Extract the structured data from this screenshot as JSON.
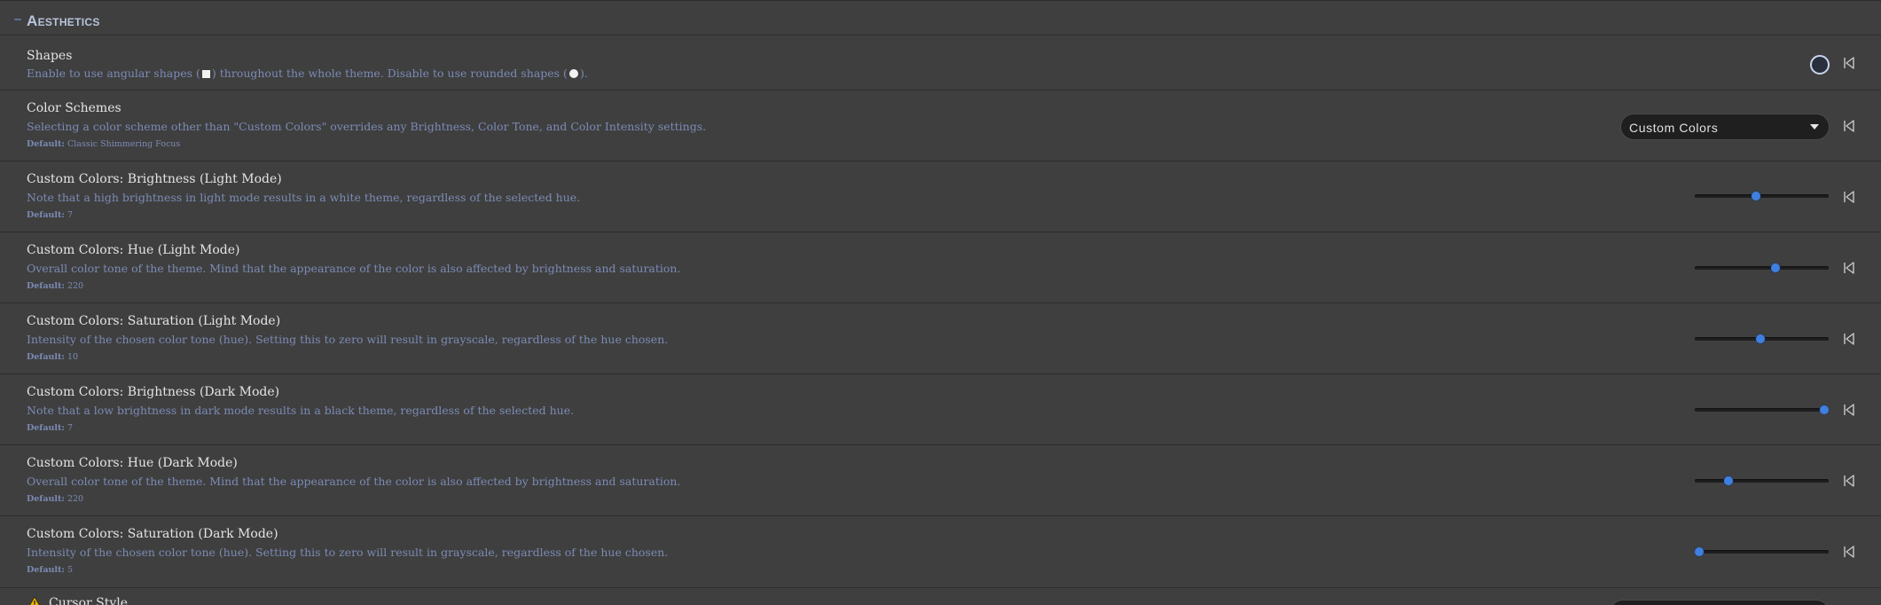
{
  "section": {
    "title": "Aesthetics"
  },
  "settings": [
    {
      "title": "Shapes",
      "desc_pre": "Enable to use angular shapes (",
      "desc_mid": ") throughout the whole theme. Disable to use rounded shapes (",
      "desc_post": ").",
      "control": "toggle",
      "toggle_on": false
    },
    {
      "title": "Color Schemes",
      "desc": "Selecting a color scheme other than \"Custom Colors\" overrides any Brightness, Color Tone, and Color Intensity settings.",
      "default_label": "Default:",
      "default_value": "Classic Shimmering Focus",
      "control": "select",
      "selected": "Custom Colors"
    },
    {
      "title": "Custom Colors: Brightness (Light Mode)",
      "desc": "Note that a high brightness in light mode results in a white theme, regardless of the selected hue.",
      "default_label": "Default:",
      "default_value": "7",
      "control": "slider",
      "slider_fraction": 0.46
    },
    {
      "title": "Custom Colors: Hue (Light Mode)",
      "desc": "Overall color tone of the theme. Mind that the appearance of the color is also affected by brightness and saturation.",
      "default_label": "Default:",
      "default_value": "220",
      "control": "slider",
      "slider_fraction": 0.6
    },
    {
      "title": "Custom Colors: Saturation (Light Mode)",
      "desc": "Intensity of the chosen color tone (hue). Setting this to zero will result in grayscale, regardless of the hue chosen.",
      "default_label": "Default:",
      "default_value": "10",
      "control": "slider",
      "slider_fraction": 0.49
    },
    {
      "title": "Custom Colors: Brightness (Dark Mode)",
      "desc": "Note that a low brightness in dark mode results in a black theme, regardless of the selected hue.",
      "default_label": "Default:",
      "default_value": "7",
      "control": "slider",
      "slider_fraction": 0.97
    },
    {
      "title": "Custom Colors: Hue (Dark Mode)",
      "desc": "Overall color tone of the theme. Mind that the appearance of the color is also affected by brightness and saturation.",
      "default_label": "Default:",
      "default_value": "220",
      "control": "slider",
      "slider_fraction": 0.25
    },
    {
      "title": "Custom Colors: Saturation (Dark Mode)",
      "desc": "Intensity of the chosen color tone (hue). Setting this to zero will result in grayscale, regardless of the hue chosen.",
      "default_label": "Default:",
      "default_value": "5",
      "control": "slider",
      "slider_fraction": 0.03
    }
  ],
  "next_setting": {
    "title": "Cursor Style"
  },
  "icons": {
    "reset": "reset-to-default-icon",
    "warning": "warning-icon",
    "dropdown": "chevron-down-icon"
  },
  "colors": {
    "background": "#3f3f3f",
    "accent": "#3f7fe0",
    "description": "#7b8bb5",
    "section_title": "#b8c4dc"
  }
}
